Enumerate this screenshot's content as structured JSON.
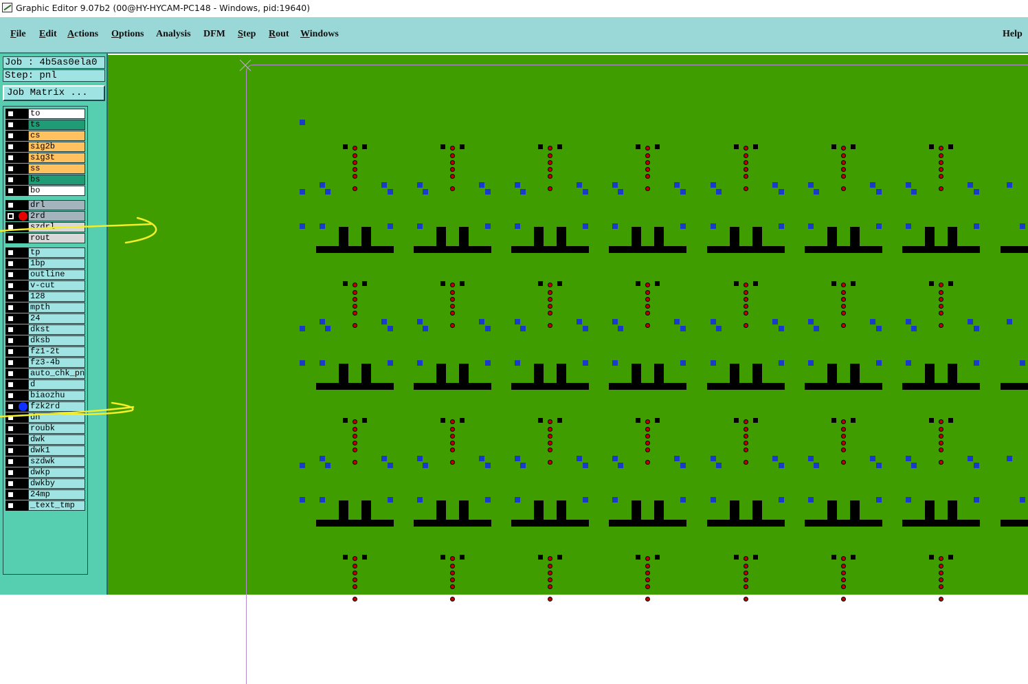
{
  "window": {
    "title": "Graphic Editor 9.07b2 (00@HY-HYCAM-PC148 - Windows, pid:19640)"
  },
  "menubar": {
    "items": [
      {
        "label": "File",
        "mnemonic": "F"
      },
      {
        "label": "Edit",
        "mnemonic": "E"
      },
      {
        "label": "Actions",
        "mnemonic": "A"
      },
      {
        "label": "Options",
        "mnemonic": "O"
      },
      {
        "label": "Analysis",
        "mnemonic": ""
      },
      {
        "label": "DFM",
        "mnemonic": ""
      },
      {
        "label": "Step",
        "mnemonic": "S"
      },
      {
        "label": "Rout",
        "mnemonic": "R"
      },
      {
        "label": "Windows",
        "mnemonic": "W"
      }
    ],
    "help": "Help"
  },
  "job": {
    "job_label": "Job : 4b5as0ela0",
    "step_label": "Step: pnl",
    "matrix_button": "Job Matrix ..."
  },
  "layers": [
    {
      "name": "to",
      "color": "#ffffff",
      "selected": false,
      "marker": ""
    },
    {
      "name": "ts",
      "color": "#1f9c76",
      "selected": false,
      "marker": ""
    },
    {
      "name": "cs",
      "color": "#ffc25e",
      "selected": false,
      "marker": ""
    },
    {
      "name": "sig2b",
      "color": "#ffc25e",
      "selected": false,
      "marker": ""
    },
    {
      "name": "sig3t",
      "color": "#ffc25e",
      "selected": false,
      "marker": ""
    },
    {
      "name": "ss",
      "color": "#ffc25e",
      "selected": false,
      "marker": ""
    },
    {
      "name": "bs",
      "color": "#1f9c76",
      "selected": false,
      "marker": ""
    },
    {
      "name": "bo",
      "color": "#ffffff",
      "selected": false,
      "marker": ""
    },
    {
      "name": "drl",
      "color": "#a4b4bc",
      "selected": false,
      "marker": ""
    },
    {
      "name": "2rd",
      "color": "#a4b4bc",
      "selected": true,
      "marker": "#e80000"
    },
    {
      "name": "szdrl",
      "color": "#d8d8d8",
      "selected": false,
      "marker": ""
    },
    {
      "name": "rout",
      "color": "#d8d8d8",
      "selected": false,
      "marker": ""
    },
    {
      "name": "tp",
      "color": "#9fe3e3",
      "selected": false,
      "marker": ""
    },
    {
      "name": "1bp",
      "color": "#9fe3e3",
      "selected": false,
      "marker": ""
    },
    {
      "name": "outline",
      "color": "#9fe3e3",
      "selected": false,
      "marker": ""
    },
    {
      "name": "v-cut",
      "color": "#9fe3e3",
      "selected": false,
      "marker": ""
    },
    {
      "name": "128",
      "color": "#9fe3e3",
      "selected": false,
      "marker": ""
    },
    {
      "name": "mpth",
      "color": "#9fe3e3",
      "selected": false,
      "marker": ""
    },
    {
      "name": "24",
      "color": "#9fe3e3",
      "selected": false,
      "marker": ""
    },
    {
      "name": "dkst",
      "color": "#9fe3e3",
      "selected": false,
      "marker": ""
    },
    {
      "name": "dksb",
      "color": "#9fe3e3",
      "selected": false,
      "marker": ""
    },
    {
      "name": "fz1-2t",
      "color": "#9fe3e3",
      "selected": false,
      "marker": ""
    },
    {
      "name": "fz3-4b",
      "color": "#9fe3e3",
      "selected": false,
      "marker": ""
    },
    {
      "name": "auto_chk_pnl",
      "color": "#9fe3e3",
      "selected": false,
      "marker": ""
    },
    {
      "name": "d",
      "color": "#9fe3e3",
      "selected": false,
      "marker": ""
    },
    {
      "name": "biaozhu",
      "color": "#9fe3e3",
      "selected": false,
      "marker": ""
    },
    {
      "name": "fzk2rd",
      "color": "#9fe3e3",
      "selected": false,
      "marker": "#1030ff"
    },
    {
      "name": "dn",
      "color": "#9fe3e3",
      "selected": false,
      "marker": ""
    },
    {
      "name": "roubk",
      "color": "#9fe3e3",
      "selected": false,
      "marker": ""
    },
    {
      "name": "dwk",
      "color": "#9fe3e3",
      "selected": false,
      "marker": ""
    },
    {
      "name": "dwk1",
      "color": "#9fe3e3",
      "selected": false,
      "marker": ""
    },
    {
      "name": "szdwk",
      "color": "#9fe3e3",
      "selected": false,
      "marker": ""
    },
    {
      "name": "dwkp",
      "color": "#9fe3e3",
      "selected": false,
      "marker": ""
    },
    {
      "name": "dwkby",
      "color": "#9fe3e3",
      "selected": false,
      "marker": ""
    },
    {
      "name": "24mp",
      "color": "#9fe3e3",
      "selected": false,
      "marker": ""
    },
    {
      "name": "_text_tmp",
      "color": "#9fe3e3",
      "selected": false,
      "marker": ""
    }
  ],
  "colors": {
    "canvas_bg": "#3f9d00",
    "menubar_bg": "#9ad8d8",
    "panel_bg": "#55cfb0",
    "pad_blue": "#1a3ac8",
    "drill_red": "#c00000",
    "annotation_yellow": "#f4ee2a",
    "profile_outline": "#b48ad0"
  }
}
